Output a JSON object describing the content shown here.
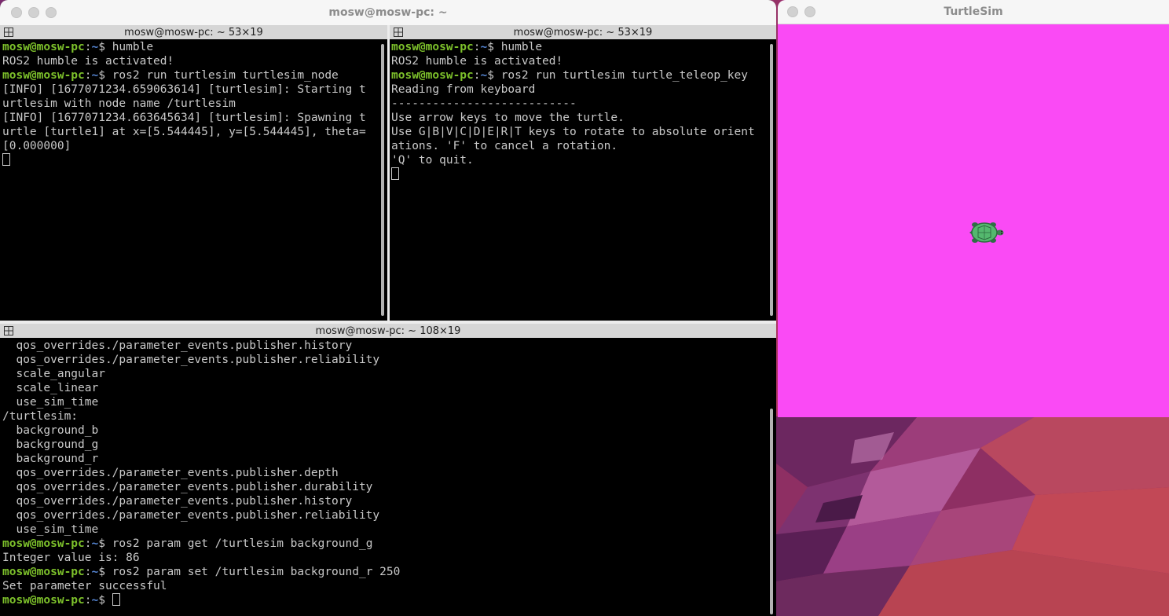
{
  "terminal_window": {
    "title": "mosw@mosw-pc: ~",
    "panes": [
      {
        "header": "mosw@mosw-pc: ~ 53×19",
        "lines": [
          {
            "user": "mosw@mosw-pc",
            "path": "~",
            "cmd": "$ humble"
          },
          {
            "text": "ROS2 humble is activated!"
          },
          {
            "user": "mosw@mosw-pc",
            "path": "~",
            "cmd": "$ ros2 run turtlesim turtlesim_node"
          },
          {
            "text": "[INFO] [1677071234.659063614] [turtlesim]: Starting t"
          },
          {
            "text": "urtlesim with node name /turtlesim"
          },
          {
            "text": "[INFO] [1677071234.663645634] [turtlesim]: Spawning t"
          },
          {
            "text": "urtle [turtle1] at x=[5.544445], y=[5.544445], theta="
          },
          {
            "text": "[0.000000]"
          }
        ]
      },
      {
        "header": "mosw@mosw-pc: ~ 53×19",
        "lines": [
          {
            "user": "mosw@mosw-pc",
            "path": "~",
            "cmd": "$ humble"
          },
          {
            "text": "ROS2 humble is activated!"
          },
          {
            "user": "mosw@mosw-pc",
            "path": "~",
            "cmd": "$ ros2 run turtlesim turtle_teleop_key"
          },
          {
            "text": "Reading from keyboard"
          },
          {
            "text": "---------------------------"
          },
          {
            "text": "Use arrow keys to move the turtle."
          },
          {
            "text": "Use G|B|V|C|D|E|R|T keys to rotate to absolute orient"
          },
          {
            "text": "ations. 'F' to cancel a rotation."
          },
          {
            "text": "'Q' to quit."
          }
        ]
      },
      {
        "header": "mosw@mosw-pc: ~ 108×19",
        "lines": [
          {
            "text": "  qos_overrides./parameter_events.publisher.history"
          },
          {
            "text": "  qos_overrides./parameter_events.publisher.reliability"
          },
          {
            "text": "  scale_angular"
          },
          {
            "text": "  scale_linear"
          },
          {
            "text": "  use_sim_time"
          },
          {
            "text": "/turtlesim:"
          },
          {
            "text": "  background_b"
          },
          {
            "text": "  background_g"
          },
          {
            "text": "  background_r"
          },
          {
            "text": "  qos_overrides./parameter_events.publisher.depth"
          },
          {
            "text": "  qos_overrides./parameter_events.publisher.durability"
          },
          {
            "text": "  qos_overrides./parameter_events.publisher.history"
          },
          {
            "text": "  qos_overrides./parameter_events.publisher.reliability"
          },
          {
            "text": "  use_sim_time"
          },
          {
            "user": "mosw@mosw-pc",
            "path": "~",
            "cmd": "$ ros2 param get /turtlesim background_g"
          },
          {
            "text": "Integer value is: 86"
          },
          {
            "user": "mosw@mosw-pc",
            "path": "~",
            "cmd": "$ ros2 param set /turtlesim background_r 250"
          },
          {
            "text": "Set parameter successful"
          },
          {
            "user": "mosw@mosw-pc",
            "path": "~",
            "cmd": "$ "
          }
        ]
      }
    ]
  },
  "turtlesim_window": {
    "title": "TurtleSim",
    "background_color": "#fa4af5",
    "turtle_icon": "turtle-icon"
  },
  "colors": {
    "prompt_user": "#7dc12b",
    "prompt_path": "#5585d2",
    "terminal_text": "#c9c9c9",
    "terminal_bg": "#000000"
  }
}
